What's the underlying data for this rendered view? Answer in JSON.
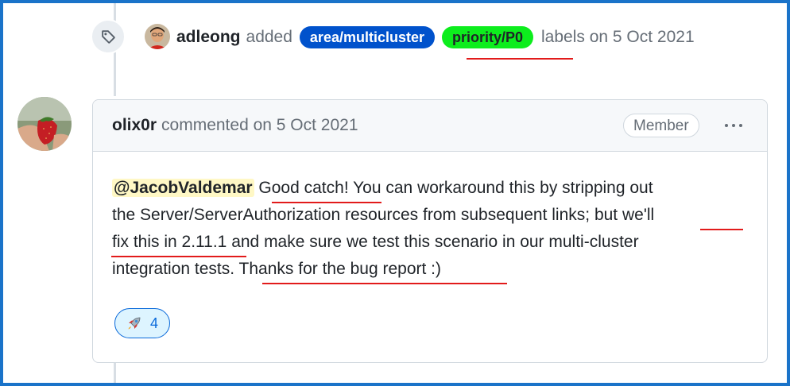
{
  "event": {
    "icon": "tag-icon",
    "actor": "adleong",
    "verb": "added",
    "labels": [
      {
        "name": "area/multicluster",
        "color": "#0052cc",
        "text_color": "#ffffff"
      },
      {
        "name": "priority/P0",
        "color": "#0ded1d",
        "text_color": "#1f2328"
      }
    ],
    "tail": "labels on 5 Oct 2021"
  },
  "comment": {
    "author": "olix0r",
    "header_text": "commented on 5 Oct 2021",
    "badge": "Member",
    "more_icon": "kebab-horizontal-icon",
    "body": {
      "mention": "@JacobValdemar",
      "p1": "Good catch",
      "p2": "! You can workaround this by stripping out",
      "line2_a": "the Server/ServerAuthorization resources from subsequent links; but ",
      "p3": "we'll",
      "p4": "fix this in 2.11.1",
      "line3_b": " and make sure we test this scenario in our multi-cluster",
      "line4_a": "integration tests. ",
      "p5": "Thanks for the bug report :)"
    },
    "reaction": {
      "emoji": "rocket-icon",
      "count": "4"
    }
  },
  "annotations": {
    "underline_color": "#e21b1b"
  }
}
